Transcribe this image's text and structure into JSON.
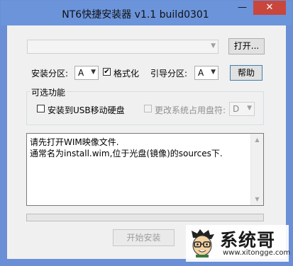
{
  "window": {
    "title": "NT6快捷安装器 v1.1 build0301",
    "minimize_glyph": "—",
    "close_glyph": "✕"
  },
  "image_path": {
    "value": "",
    "arrow_icon": "chevron-down-icon"
  },
  "open_button": "打开...",
  "install_partition": {
    "label": "安装分区:",
    "value": "A"
  },
  "format_checkbox": {
    "label": "格式化",
    "checked": true
  },
  "boot_partition": {
    "label": "引导分区:",
    "value": "A"
  },
  "help_button": "帮助",
  "options_group": {
    "title": "可选功能",
    "usb_checkbox": {
      "label": "安装到USB移动硬盘",
      "checked": false
    },
    "change_letter_checkbox": {
      "label": "更改系统占用盘符:",
      "checked": false,
      "enabled": false
    },
    "drive_letter": "D"
  },
  "log": {
    "lines": [
      "请先打开WIM映像文件.",
      "通常名为install.wim,位于光盘(镜像)的sources下."
    ]
  },
  "progress": {
    "value": 0
  },
  "start_button": "开始安装",
  "watermark": {
    "name": "系统哥",
    "url": "www.xitongge.com"
  },
  "colors": {
    "titlebar": "#6b94db",
    "close_button": "#c9463d",
    "client_bg": "#f0f0f0"
  }
}
